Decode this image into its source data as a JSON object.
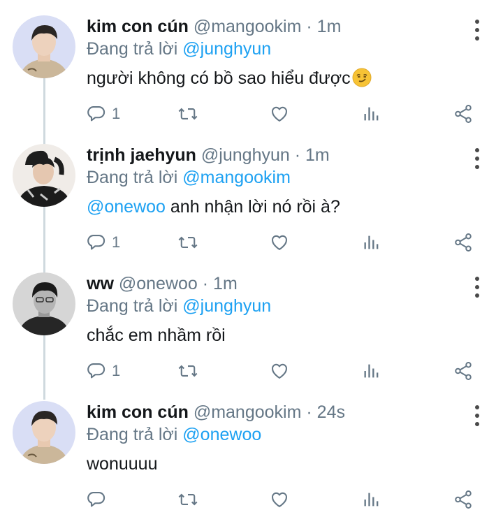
{
  "tweets": [
    {
      "name": "kim con cún",
      "handle": "@mangookim",
      "separator": "·",
      "time": "1m",
      "replying_prefix": "Đang trả lời",
      "replying_to": "@junghyun",
      "body_text": "người không có bồ sao hiểu được",
      "body_emoji": "smirking-face-emoji",
      "reply_count": "1"
    },
    {
      "name": "trịnh jaehyun",
      "handle": "@junghyun",
      "separator": "·",
      "time": "1m",
      "replying_prefix": "Đang trả lời",
      "replying_to": "@mangookim",
      "body_mention": "@onewoo",
      "body_text": " anh nhận lời nó rồi à?",
      "reply_count": "1"
    },
    {
      "name": "ww",
      "handle": "@onewoo",
      "separator": "·",
      "time": "1m",
      "replying_prefix": "Đang trả lời",
      "replying_to": "@junghyun",
      "body_text": "chắc em nhầm rồi",
      "reply_count": "1"
    },
    {
      "name": "kim con cún",
      "handle": "@mangookim",
      "separator": "·",
      "time": "24s",
      "replying_prefix": "Đang trả lời",
      "replying_to": "@onewoo",
      "body_text": "wonuuuu",
      "reply_count": ""
    }
  ],
  "colors": {
    "link": "#1da1f2",
    "secondary_text": "#657786",
    "thread_line": "#cfd9de"
  },
  "icons": [
    "reply-icon",
    "retweet-icon",
    "like-icon",
    "analytics-icon",
    "share-icon",
    "more-options-icon"
  ]
}
